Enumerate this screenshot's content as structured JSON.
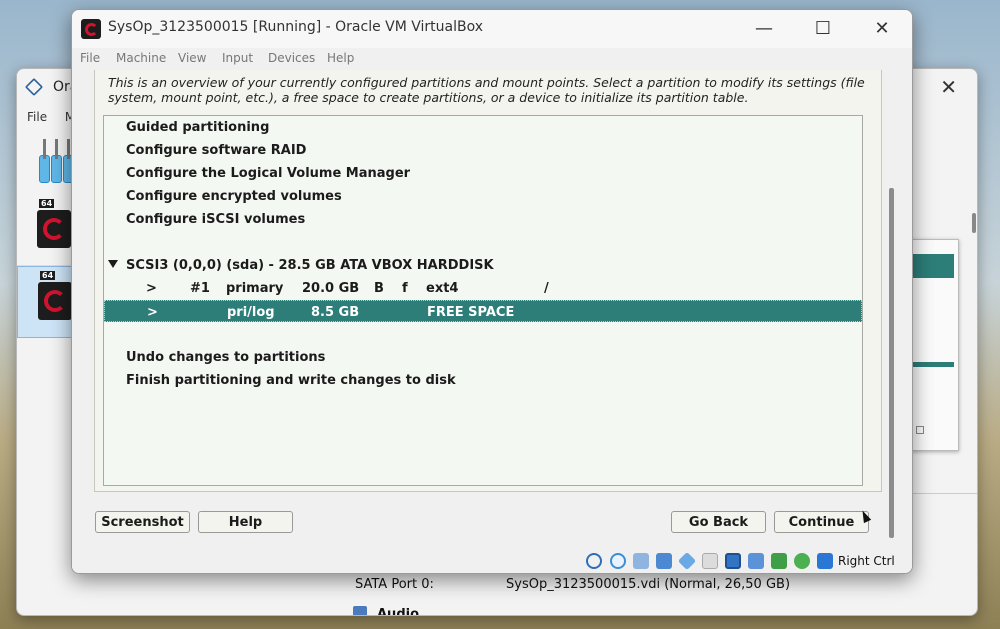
{
  "manager": {
    "title_partial": "Ora",
    "menu": [
      "File",
      "M"
    ],
    "vm_badge": "64",
    "storage": {
      "port_label": "SATA Port 0:",
      "port_value": "SysOp_3123500015.vdi (Normal, 26,50 GB)"
    },
    "section_audio": "Audio"
  },
  "vm_window": {
    "title": "SysOp_3123500015 [Running] - Oracle VM VirtualBox",
    "menu": [
      "File",
      "Machine",
      "View",
      "Input",
      "Devices",
      "Help"
    ],
    "host_key": "Right Ctrl",
    "status_icons": [
      "hard-disk-icon",
      "optical-drive-icon",
      "audio-icon",
      "network-icon",
      "usb-icon",
      "shared-folder-icon",
      "display-icon",
      "recording-icon",
      "virtualization-icon",
      "mouse-integration-icon",
      "download-icon"
    ]
  },
  "installer": {
    "description": "This is an overview of your currently configured partitions and mount points. Select a partition to modify its settings (file system, mount point, etc.), a free space to create partitions, or a device to initialize its partition table.",
    "actions": [
      "Guided partitioning",
      "Configure software RAID",
      "Configure the Logical Volume Manager",
      "Configure encrypted volumes",
      "Configure iSCSI volumes"
    ],
    "disk": "SCSI3 (0,0,0) (sda) - 28.5 GB ATA VBOX HARDDISK",
    "partitions": [
      {
        "arrow": ">",
        "num": "#1",
        "type": "primary",
        "size": "20.0 GB",
        "boot": "B",
        "fmt": "f",
        "fs": "ext4",
        "mount": "/"
      },
      {
        "arrow": ">",
        "num": "",
        "type": "pri/log",
        "size": "8.5 GB",
        "boot": "",
        "fmt": "",
        "fs": "FREE SPACE",
        "mount": ""
      }
    ],
    "final_actions": [
      "Undo changes to partitions",
      "Finish partitioning and write changes to disk"
    ],
    "buttons": {
      "screenshot": "Screenshot",
      "help": "Help",
      "go_back": "Go Back",
      "continue": "Continue"
    }
  },
  "colors": {
    "selection": "#2d7d78",
    "debian_red": "#d0142f"
  }
}
